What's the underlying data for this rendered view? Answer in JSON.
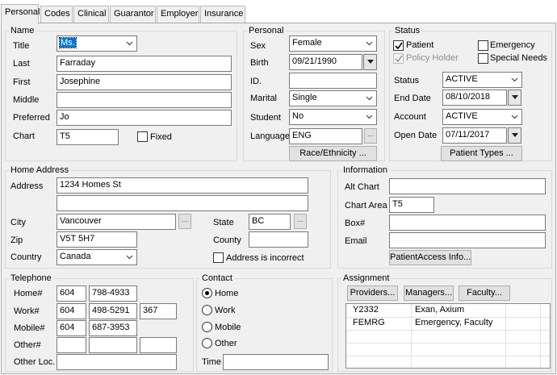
{
  "tabs": [
    "Personal",
    "Codes",
    "Clinical",
    "Guarantor",
    "Employer",
    "Insurance"
  ],
  "active_tab": "Personal",
  "name_group": {
    "title": "Name",
    "title_label": "Title",
    "title_value": "Ms.",
    "last_label": "Last",
    "last_value": "Farraday",
    "first_label": "First",
    "first_value": "Josephine",
    "middle_label": "Middle",
    "middle_value": "",
    "preferred_label": "Preferred",
    "preferred_value": "Jo",
    "chart_label": "Chart",
    "chart_value": "T5",
    "fixed_label": "Fixed",
    "fixed_checked": false
  },
  "personal_group": {
    "title": "Personal",
    "sex_label": "Sex",
    "sex_value": "Female",
    "birth_label": "Birth",
    "birth_value": "09/21/1990",
    "id_label": "ID.",
    "id_value": "",
    "marital_label": "Marital",
    "marital_value": "Single",
    "student_label": "Student",
    "student_value": "No",
    "language_label": "Language",
    "language_value": "ENG",
    "race_button": "Race/Ethnicity ..."
  },
  "status_group": {
    "title": "Status",
    "patient_label": "Patient",
    "patient_checked": true,
    "emergency_label": "Emergency",
    "emergency_checked": false,
    "policy_holder_label": "Policy Holder",
    "policy_holder_checked": true,
    "special_needs_label": "Special Needs",
    "special_needs_checked": false,
    "status_label": "Status",
    "status_value": "ACTIVE",
    "end_date_label": "End Date",
    "end_date_value": "08/10/2018",
    "account_label": "Account",
    "account_value": "ACTIVE",
    "open_date_label": "Open Date",
    "open_date_value": "07/11/2017",
    "patient_types_button": "Patient Types ..."
  },
  "home_address": {
    "title": "Home Address",
    "address_label": "Address",
    "address1": "1234 Homes St",
    "address2": "",
    "city_label": "City",
    "city_value": "Vancouver",
    "state_label": "State",
    "state_value": "BC",
    "zip_label": "Zip",
    "zip_value": "V5T 5H7",
    "county_label": "County",
    "county_value": "",
    "country_label": "Country",
    "country_value": "Canada",
    "incorrect_label": "Address is incorrect",
    "incorrect_checked": false
  },
  "information": {
    "title": "Information",
    "alt_chart_label": "Alt Chart",
    "alt_chart_value": "",
    "chart_area_label": "Chart Area",
    "chart_area_value": "T5",
    "box_label": "Box#",
    "box_value": "",
    "email_label": "Email",
    "email_value": "",
    "patient_access_button": "PatientAccess Info..."
  },
  "telephone": {
    "title": "Telephone",
    "home_label": "Home#",
    "home_area": "604",
    "home_number": "798-4933",
    "work_label": "Work#",
    "work_area": "604",
    "work_number": "498-5291",
    "work_ext": "367",
    "mobile_label": "Mobile#",
    "mobile_area": "604",
    "mobile_number": "687-3953",
    "other_label": "Other#",
    "other_area": "",
    "other_number": "",
    "other_ext": "",
    "other_loc_label": "Other Loc.",
    "other_loc_value": ""
  },
  "contact": {
    "title": "Contact",
    "options": [
      "Home",
      "Work",
      "Mobile",
      "Other"
    ],
    "selected": "Home",
    "time_label": "Time",
    "time_value": ""
  },
  "assignment": {
    "title": "Assignment",
    "providers_button": "Providers...",
    "managers_button": "Managers...",
    "faculty_button": "Faculty...",
    "rows": [
      {
        "code": "Y2332",
        "name": "Exan, Axium"
      },
      {
        "code": "FEMRG",
        "name": "Emergency, Faculty"
      }
    ]
  },
  "icons": [
    "chevron-down-icon",
    "checkmark-icon",
    "ellipsis-icon",
    "radio-dot-icon"
  ]
}
